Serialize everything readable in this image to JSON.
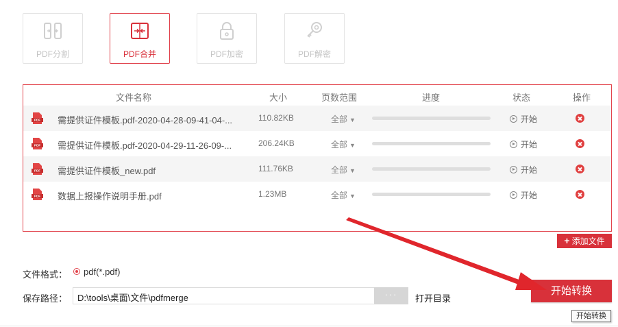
{
  "tools": [
    {
      "label": "PDF分割",
      "active": false
    },
    {
      "label": "PDF合并",
      "active": true
    },
    {
      "label": "PDF加密",
      "active": false
    },
    {
      "label": "PDF解密",
      "active": false
    }
  ],
  "table": {
    "headers": {
      "name": "文件名称",
      "size": "大小",
      "range": "页数范围",
      "progress": "进度",
      "status": "状态",
      "action": "操作"
    },
    "rows": [
      {
        "name": "需提供证件模板.pdf-2020-04-28-09-41-04-...",
        "size": "110.82KB",
        "range": "全部",
        "progress": 0,
        "status": "开始"
      },
      {
        "name": "需提供证件模板.pdf-2020-04-29-11-26-09-...",
        "size": "206.24KB",
        "range": "全部",
        "progress": 0,
        "status": "开始"
      },
      {
        "name": "需提供证件模板_new.pdf",
        "size": "111.76KB",
        "range": "全部",
        "progress": 0,
        "status": "开始"
      },
      {
        "name": "数据上报操作说明手册.pdf",
        "size": "1.23MB",
        "range": "全部",
        "progress": 0,
        "status": "开始"
      }
    ]
  },
  "add_file_label": "添加文件",
  "format": {
    "label": "文件格式：",
    "value": "pdf(*.pdf)"
  },
  "save_path": {
    "label": "保存路径：",
    "value": "D:\\tools\\桌面\\文件\\pdfmerge",
    "browse_label": "···",
    "open_dir_label": "打开目录"
  },
  "start_button_label": "开始转换",
  "tooltip": "开始转换",
  "colors": {
    "accent": "#d8313a",
    "inactive_icon": "#cfcfcf"
  }
}
